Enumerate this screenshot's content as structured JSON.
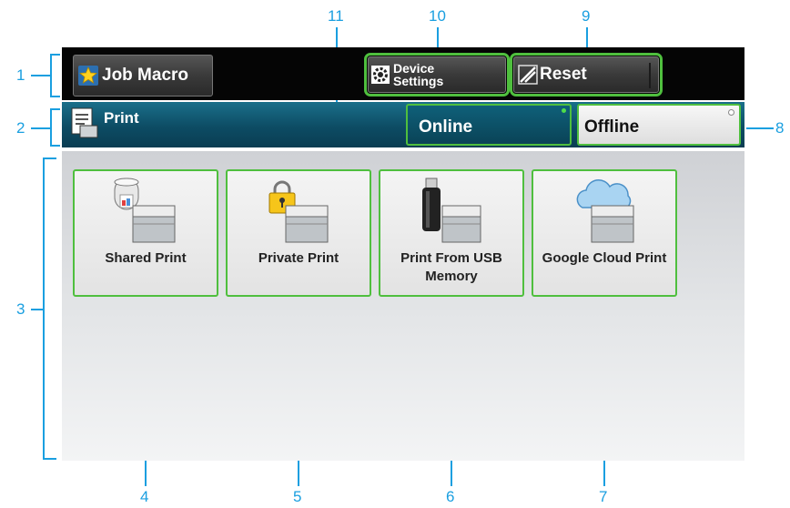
{
  "callouts": [
    "1",
    "2",
    "3",
    "4",
    "5",
    "6",
    "7",
    "8",
    "9",
    "10",
    "11"
  ],
  "topbar": {
    "job_macro_label": "Job Macro",
    "device_settings_line1": "Device",
    "device_settings_line2": "Settings",
    "reset_label": "Reset"
  },
  "statusbar": {
    "title": "Print",
    "online_label": "Online",
    "offline_label": "Offline"
  },
  "tiles": [
    {
      "label": "Shared Print",
      "icon": "shared-print-icon"
    },
    {
      "label": "Private Print",
      "icon": "private-print-icon"
    },
    {
      "label": "Print From USB Memory",
      "icon": "usb-print-icon"
    },
    {
      "label": "Google Cloud Print",
      "icon": "cloud-print-icon"
    }
  ],
  "colors": {
    "callout": "#1a9fe0",
    "highlight": "#4fbf3e",
    "topbar": "#050505",
    "statusbar": "#0d4c64"
  }
}
